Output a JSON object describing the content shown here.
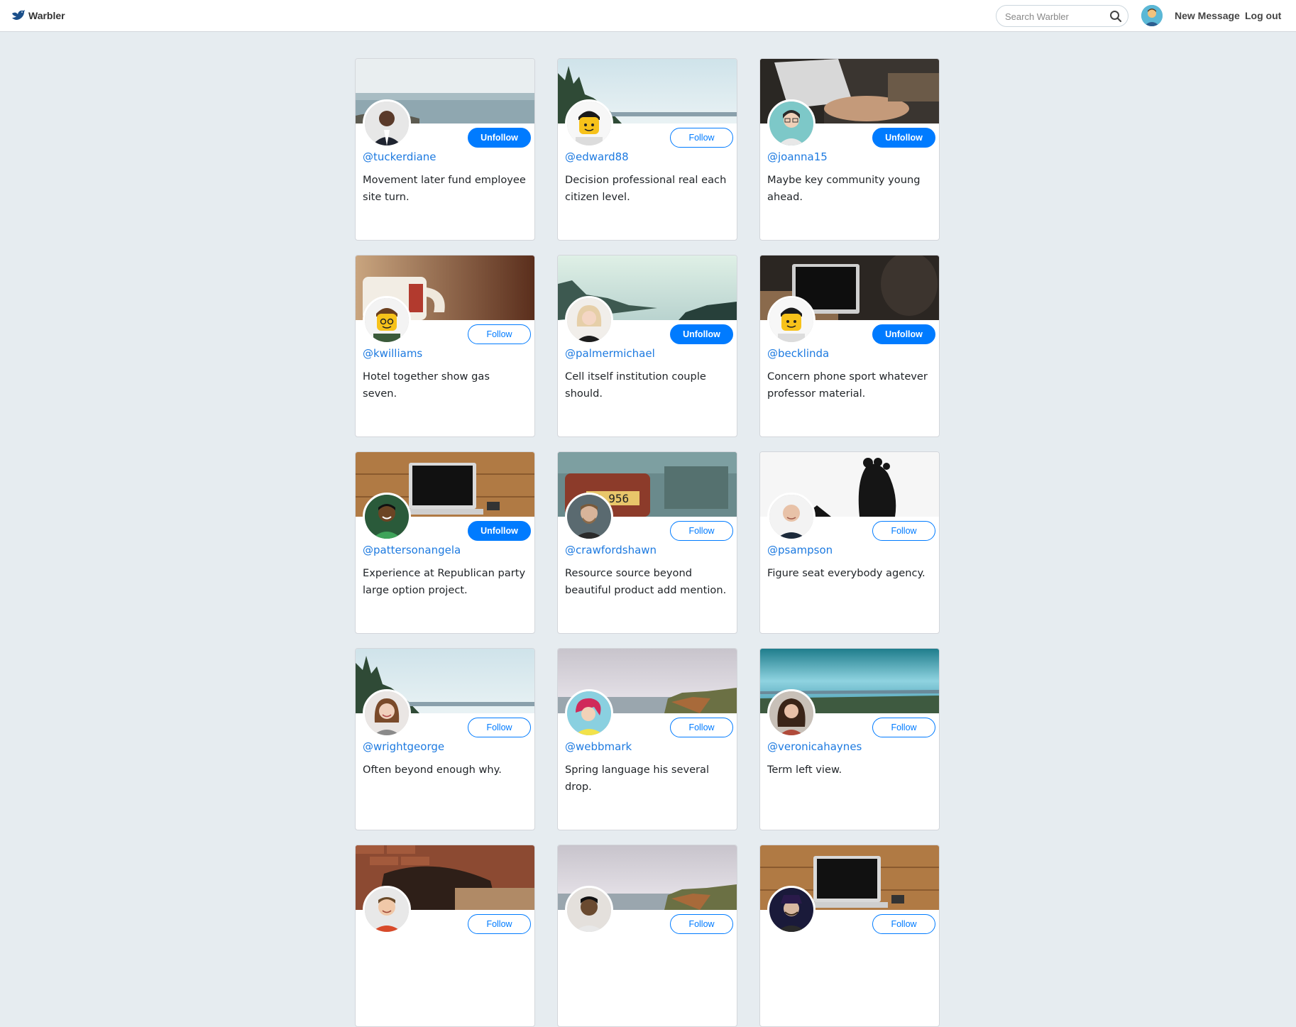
{
  "app": {
    "brand": "Warbler"
  },
  "search": {
    "placeholder": "Search Warbler",
    "value": ""
  },
  "nav": {
    "new_message": "New Message",
    "logout": "Log out"
  },
  "colors": {
    "accent": "#007bff",
    "link": "#1d7ae0",
    "background": "#e6ecf0"
  },
  "users": [
    {
      "handle": "@tuckerdiane",
      "bio": "Movement later fund employee site turn.",
      "button": "Unfollow",
      "following": true,
      "header": "sea-sky",
      "avatar": "man-suit"
    },
    {
      "handle": "@edward88",
      "bio": "Decision professional real each citizen level.",
      "button": "Follow",
      "following": false,
      "header": "trees-lake",
      "avatar": "lego"
    },
    {
      "handle": "@joanna15",
      "bio": "Maybe key community young ahead.",
      "button": "Unfollow",
      "following": true,
      "header": "laptop-typing",
      "avatar": "woman-glasses"
    },
    {
      "handle": "@kwilliams",
      "bio": "Hotel together show gas seven.",
      "button": "Follow",
      "following": false,
      "header": "coffee-mug",
      "avatar": "lego-glasses"
    },
    {
      "handle": "@palmermichael",
      "bio": "Cell itself institution couple should.",
      "button": "Unfollow",
      "following": true,
      "header": "misty-hills",
      "avatar": "woman-blonde"
    },
    {
      "handle": "@becklinda",
      "bio": "Concern phone sport whatever professor material.",
      "button": "Unfollow",
      "following": true,
      "header": "laptop-dark",
      "avatar": "lego"
    },
    {
      "handle": "@pattersonangela",
      "bio": "Experience at Republican party large option project.",
      "button": "Unfollow",
      "following": true,
      "header": "laptop-wood",
      "avatar": "man-smiling"
    },
    {
      "handle": "@crawfordshawn",
      "bio": "Resource source beyond beautiful product add mention.",
      "button": "Follow",
      "following": false,
      "header": "vintage-car",
      "avatar": "man-beard"
    },
    {
      "handle": "@psampson",
      "bio": "Figure seat everybody agency.",
      "button": "Follow",
      "following": false,
      "header": "feet-white",
      "avatar": "man-bald"
    },
    {
      "handle": "@wrightgeorge",
      "bio": "Often beyond enough why.",
      "button": "Follow",
      "following": false,
      "header": "trees-lake",
      "avatar": "woman-brunette"
    },
    {
      "handle": "@webbmark",
      "bio": "Spring language his several drop.",
      "button": "Follow",
      "following": false,
      "header": "coast-cliff",
      "avatar": "woman-redhair"
    },
    {
      "handle": "@veronicahaynes",
      "bio": "Term left view.",
      "button": "Follow",
      "following": false,
      "header": "blue-lake",
      "avatar": "woman-curly"
    },
    {
      "handle": "",
      "bio": "",
      "button": "Follow",
      "following": false,
      "header": "brick-bag",
      "avatar": "man-ginger"
    },
    {
      "handle": "",
      "bio": "",
      "button": "Follow",
      "following": false,
      "header": "coast-cliff",
      "avatar": "man-dark"
    },
    {
      "handle": "",
      "bio": "",
      "button": "Follow",
      "following": false,
      "header": "laptop-wood",
      "avatar": "man-hat"
    }
  ]
}
